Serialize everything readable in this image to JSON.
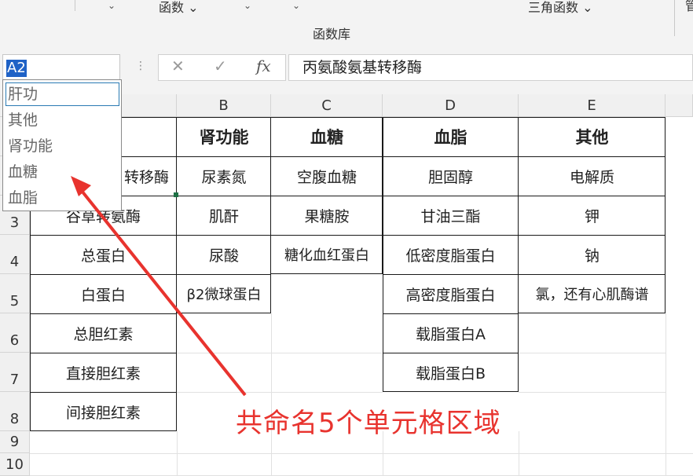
{
  "ribbon": {
    "func_label": "函数",
    "trig_label": "三角函数",
    "library_label": "函数库",
    "right_label": "管"
  },
  "name_box": {
    "value": "A2"
  },
  "formula_bar": {
    "cancel_icon": "✕",
    "confirm_icon": "✓",
    "fx_icon": "fx",
    "formula": "丙氨酸氨基转移酶"
  },
  "dropdown": {
    "items": [
      "肝功",
      "其他",
      "肾功能",
      "血糖",
      "血脂"
    ]
  },
  "columns": [
    "B",
    "C",
    "D",
    "E"
  ],
  "rows": [
    "3",
    "4",
    "5",
    "6",
    "7",
    "8",
    "9",
    "10"
  ],
  "cells": {
    "A2": "转移酶",
    "A3": "谷草转氨酶",
    "A4": "总蛋白",
    "A5": "白蛋白",
    "A6": "总胆红素",
    "A7": "直接胆红素",
    "A8": "间接胆红素",
    "B1": "肾功能",
    "B2": "尿素氮",
    "B3": "肌酐",
    "B4": "尿酸",
    "B5": "β2微球蛋白",
    "C1": "血糖",
    "C2": "空腹血糖",
    "C3": "果糖胺",
    "C4": "糖化血红蛋白",
    "D1": "血脂",
    "D2": "胆固醇",
    "D3": "甘油三酯",
    "D4": "低密度脂蛋白",
    "D5": "高密度脂蛋白",
    "D6": "载脂蛋白A",
    "D7": "载脂蛋白B",
    "E1": "其他",
    "E2": "电解质",
    "E3": "钾",
    "E4": "钠",
    "E5": "氯，还有心肌酶谱"
  },
  "annotation": "共命名5个单元格区域",
  "colors": {
    "accent": "#1f62c6",
    "annotation": "#e8332e",
    "selection": "#1e7145"
  }
}
